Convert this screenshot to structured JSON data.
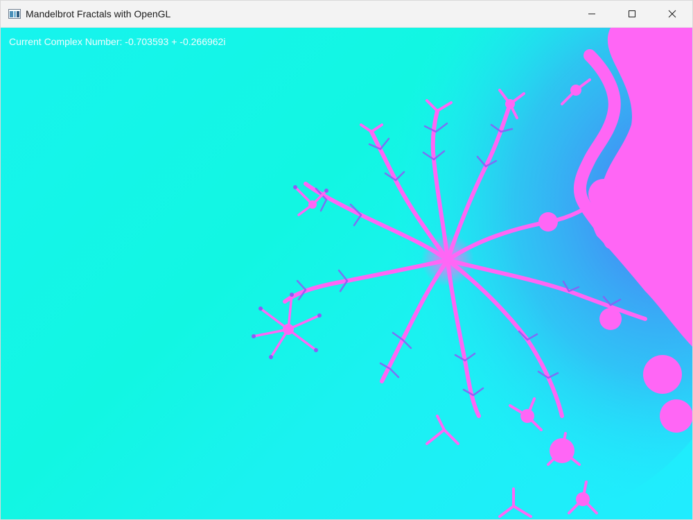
{
  "window": {
    "title": "Mandelbrot Fractals with OpenGL",
    "controls": {
      "minimize_icon": "minimize-icon",
      "maximize_icon": "maximize-icon",
      "close_icon": "close-icon"
    }
  },
  "overlay": {
    "complex_number_text": "Current Complex Number: -0.703593 + -0.266962i"
  },
  "colors": {
    "background_cyan": "#17f4ee",
    "fractal_pink": "#ff66f5",
    "fractal_blue": "#4f6cf3",
    "fractal_purple": "#8b5cf6"
  }
}
